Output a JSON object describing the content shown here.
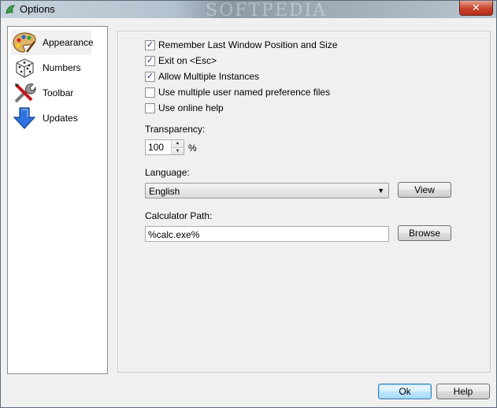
{
  "window": {
    "title": "Options",
    "close_label": "✕"
  },
  "watermark": "SOFTPEDIA",
  "nav": {
    "items": [
      {
        "label": "Appearance",
        "icon": "palette-icon",
        "selected": true
      },
      {
        "label": "Numbers",
        "icon": "dice-icon",
        "selected": false
      },
      {
        "label": "Toolbar",
        "icon": "tools-icon",
        "selected": false
      },
      {
        "label": "Updates",
        "icon": "down-arrow-icon",
        "selected": false
      }
    ]
  },
  "appearance": {
    "options": [
      {
        "label": "Remember Last Window Position and Size",
        "checked": true
      },
      {
        "label": "Exit on <Esc>",
        "checked": true
      },
      {
        "label": "Allow Multiple Instances",
        "checked": true
      },
      {
        "label": "Use multiple user named preference files",
        "checked": false
      },
      {
        "label": "Use online help",
        "checked": false
      }
    ],
    "transparency_label": "Transparency:",
    "transparency_value": "100",
    "transparency_unit": "%",
    "language_label": "Language:",
    "language_value": "English",
    "view_button": "View",
    "calc_path_label": "Calculator Path:",
    "calc_path_value": "%calc.exe%",
    "browse_button": "Browse"
  },
  "footer": {
    "ok_button": "Ok",
    "help_button": "Help"
  },
  "colors": {
    "titlebar": "#b3c2cf",
    "close": "#c7422b",
    "default_button": "#a7d9f5"
  }
}
